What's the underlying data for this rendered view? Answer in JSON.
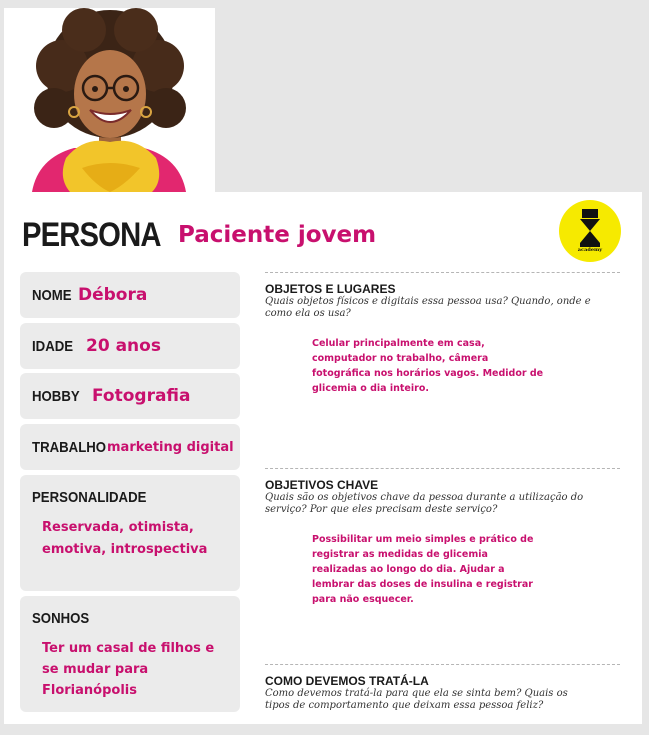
{
  "header": {
    "title": "PERSONA",
    "subtitle": "Paciente jovem",
    "logo_text": "academy"
  },
  "fields": {
    "nome": {
      "label": "NOME",
      "value": "Débora"
    },
    "idade": {
      "label": "IDADE",
      "value": "20 anos"
    },
    "hobby": {
      "label": "HOBBY",
      "value": "Fotografia"
    },
    "trabalho": {
      "label": "TRABALHO",
      "value": "marketing digital"
    },
    "personalidade": {
      "label": "PERSONALIDADE",
      "value": "Reservada, otimista, emotiva, introspectiva"
    },
    "sonhos": {
      "label": "SONHOS",
      "value": "Ter um casal de filhos e se mudar para Florianópolis"
    }
  },
  "sections": {
    "objetos": {
      "title": "OBJETOS E LUGARES",
      "question": "Quais objetos físicos e digitais essa pessoa usa? Quando, onde e como ela os usa?",
      "answer": "Celular principalmente em casa, computador no trabalho, câmera fotográfica nos horários vagos. Medidor de glicemia o dia inteiro."
    },
    "objetivos": {
      "title": "OBJETIVOS CHAVE",
      "question": "Quais são os objetivos chave da pessoa durante a utilização do serviço? Por que eles precisam deste serviço?",
      "answer": "Possibilitar um meio simples e prático de registrar as medidas de glicemia realizadas ao longo do dia. Ajudar a lembrar das doses de insulina e registrar para não esquecer."
    },
    "tratar": {
      "title": "COMO DEVEMOS TRATÁ-LA",
      "question": "Como devemos tratá-la para que ela se sinta bem? Quais os tipos de comportamento que deixam essa pessoa feliz?"
    }
  },
  "colors": {
    "accent": "#c8106e",
    "logo_bg": "#f6ea00"
  }
}
